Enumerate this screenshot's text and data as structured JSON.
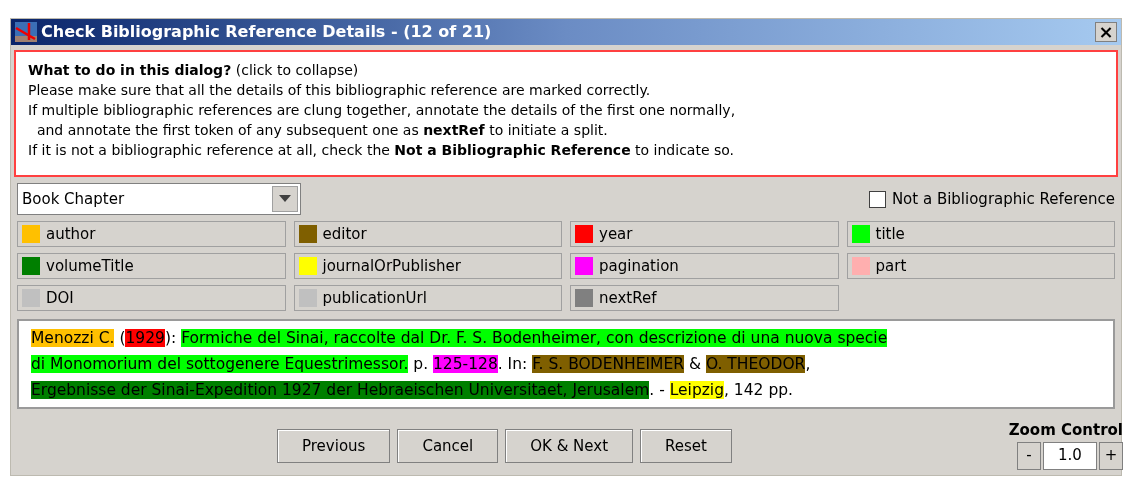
{
  "window": {
    "title": "Check Bibliographic Reference Details - (12 of 21)",
    "close": "×"
  },
  "instructions": [
    "**What to do in this dialog?** (click to collapse)",
    "Please make sure that all the details of this bibliographic reference are marked correctly.",
    "If multiple bibliographic references are clung together, annotate the details of the first one normally,",
    "  and annotate the first token of any subsequent one as **nextRef** to initiate a split.",
    "If it is not a bibliographic reference at all, check the **Not a Bibliographic Reference** to indicate so."
  ],
  "reference_type": {
    "value": "Book Chapter"
  },
  "not_a_reference": {
    "label": "Not a Bibliographic Reference",
    "checked": false
  },
  "legend": [
    {
      "label": "author",
      "color": "#ffc000"
    },
    {
      "label": "editor",
      "color": "#7f5f00"
    },
    {
      "label": "year",
      "color": "#ff0000"
    },
    {
      "label": "title",
      "color": "#00ff00"
    },
    {
      "label": "volumeTitle",
      "color": "#007f00"
    },
    {
      "label": "journalOrPublisher",
      "color": "#ffff00"
    },
    {
      "label": "pagination",
      "color": "#ff00ff"
    },
    {
      "label": "part",
      "color": "#ffafaf"
    },
    {
      "label": "DOI",
      "color": "#c0c0c0"
    },
    {
      "label": "publicationUrl",
      "color": "#c0c0c0"
    },
    {
      "label": "nextRef",
      "color": "#808080"
    }
  ],
  "reference_lines": [
    [
      {
        "text": "Menozzi C.",
        "color": "#ffc000"
      },
      {
        "text": " ("
      },
      {
        "text": "1929",
        "color": "#ff0000"
      },
      {
        "text": "): "
      },
      {
        "text": "Formiche del Sinai, raccolte dal Dr. F. S. Bodenheimer, con descrizione di una nuova specie",
        "color": "#00ff00"
      }
    ],
    [
      {
        "text": "di Monomorium del sottogenere Equestrimessor.",
        "color": "#00ff00"
      },
      {
        "text": " p. "
      },
      {
        "text": "125-128",
        "color": "#ff00ff"
      },
      {
        "text": ". In: "
      },
      {
        "text": "F. S. BODENHEIMER",
        "color": "#7f5f00"
      },
      {
        "text": " & "
      },
      {
        "text": "O. THEODOR",
        "color": "#7f5f00"
      },
      {
        "text": ","
      }
    ],
    [
      {
        "text": "Ergebnisse der Sinai-Expedition 1927 der Hebraeischen Universitaet, Jerusalem",
        "color": "#007f00"
      },
      {
        "text": ". - "
      },
      {
        "text": "Leipzig",
        "color": "#ffff00"
      },
      {
        "text": ", 142 pp."
      }
    ]
  ],
  "buttons": [
    "Previous",
    "Cancel",
    "OK & Next",
    "Reset"
  ],
  "zoom_control": {
    "label": "Zoom Control",
    "minus": "-",
    "value": "1.0",
    "plus": "+"
  }
}
